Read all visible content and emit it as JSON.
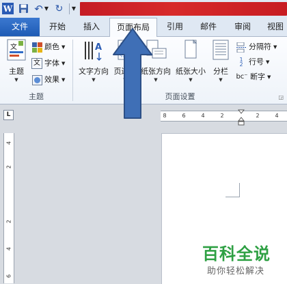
{
  "titlebar": {
    "app_icon": "W"
  },
  "tabs": {
    "file": "文件",
    "home": "开始",
    "insert": "插入",
    "layout": "页面布局",
    "references": "引用",
    "mailings": "邮件",
    "review": "审阅",
    "view": "视图"
  },
  "ribbon": {
    "theme_group": {
      "label": "主题",
      "theme_button": "主题",
      "colors": "颜色",
      "fonts": "字体",
      "effects": "效果"
    },
    "page_setup_group": {
      "label": "页面设置",
      "text_direction": "文字方向",
      "margins": "页边距",
      "orientation": "纸张方向",
      "size": "纸张大小",
      "columns": "分栏",
      "breaks": "分隔符",
      "line_numbers": "行号",
      "hyphenation": "断字"
    }
  },
  "ruler": {
    "corner": "L",
    "ticks": [
      "8",
      "6",
      "4",
      "2",
      "",
      "2",
      "4"
    ],
    "vticks": [
      "4",
      "2",
      "",
      "2",
      "4",
      "6"
    ]
  },
  "watermark": {
    "title": "百科全说",
    "subtitle": "助你轻松解决"
  },
  "colors": {
    "accent": "#2b5cb5",
    "arrow": "#3f6fb6",
    "watermark_green": "#2ea043",
    "redaction": "#c51c25"
  }
}
